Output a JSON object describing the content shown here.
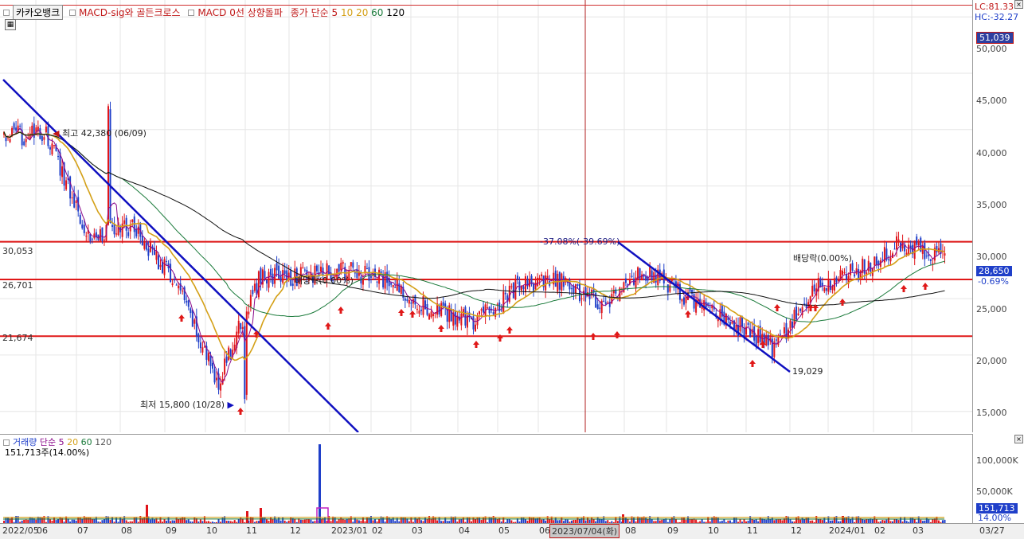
{
  "legend": {
    "stock_name": "카카오뱅크",
    "indicator1": "MACD-sig와 골든크로스",
    "indicator2": "MACD 0선 상향돌파",
    "ma_label": "종가 단순 5",
    "ma_periods": [
      "10",
      "20",
      "60",
      "120"
    ]
  },
  "price_axis": {
    "ticks": [
      "50,000",
      "45,000",
      "40,000",
      "35,000",
      "30,000",
      "25,000",
      "20,000",
      "15,000"
    ],
    "lc": "LC:81.33",
    "hc": "HC:-32.27",
    "top_box": "51,039",
    "current_price": "28,650",
    "current_change": "-0.69%"
  },
  "h_lines": {
    "top": "30,053",
    "middle": "26,701",
    "bottom": "21,674"
  },
  "annotations": {
    "high": "최고 42,380 (06/09)",
    "low": "최저 15,800 (10/28)",
    "change": "-37.08%(-39.69%)",
    "dividend1": "배당락(0.00%)",
    "dividend2": "배당락(0.00%)",
    "trend_end": "19,029"
  },
  "volume_legend": {
    "label": "거래량",
    "ma_label": "단순 5",
    "ma_periods": [
      "20",
      "60",
      "120"
    ],
    "current": "151,713주(14.00%)"
  },
  "volume_axis": {
    "ticks": [
      "100,000K",
      "50,000K"
    ],
    "box_value": "151,713",
    "box_pct": "14.00%"
  },
  "date_axis": {
    "labels": [
      "2022/05",
      "06",
      "07",
      "08",
      "09",
      "10",
      "11",
      "12",
      "2023/01",
      "02",
      "03",
      "04",
      "05",
      "06",
      "08",
      "09",
      "10",
      "11",
      "12",
      "2024/01",
      "02",
      "03"
    ],
    "cursor": "2023/07/04(화)",
    "right": "03/27"
  },
  "colors": {
    "up": "#e0141a",
    "down": "#1f3fc9",
    "trend": "#1010c0",
    "ma5": "#8b0a8b",
    "ma20": "#d4a017",
    "ma60": "#1a7a3a",
    "ma120": "#111111"
  },
  "chart_data": {
    "type": "candlestick",
    "x": [
      "2022/05",
      "06",
      "07",
      "08",
      "09",
      "10",
      "11",
      "12",
      "2023/01",
      "02",
      "03",
      "04",
      "05",
      "06",
      "07",
      "08",
      "09",
      "10",
      "11",
      "12",
      "2024/01",
      "02",
      "03"
    ],
    "close_approx": [
      39500,
      39500,
      30500,
      31500,
      26500,
      17500,
      27000,
      27000,
      27500,
      26500,
      24000,
      23000,
      26000,
      26500,
      24500,
      27500,
      25000,
      23000,
      20500,
      26000,
      27500,
      30000,
      28650
    ],
    "ylim": [
      13000,
      51500
    ],
    "reference_lines": [
      30053,
      26701,
      21674
    ],
    "high": 42380,
    "low": 15800
  }
}
